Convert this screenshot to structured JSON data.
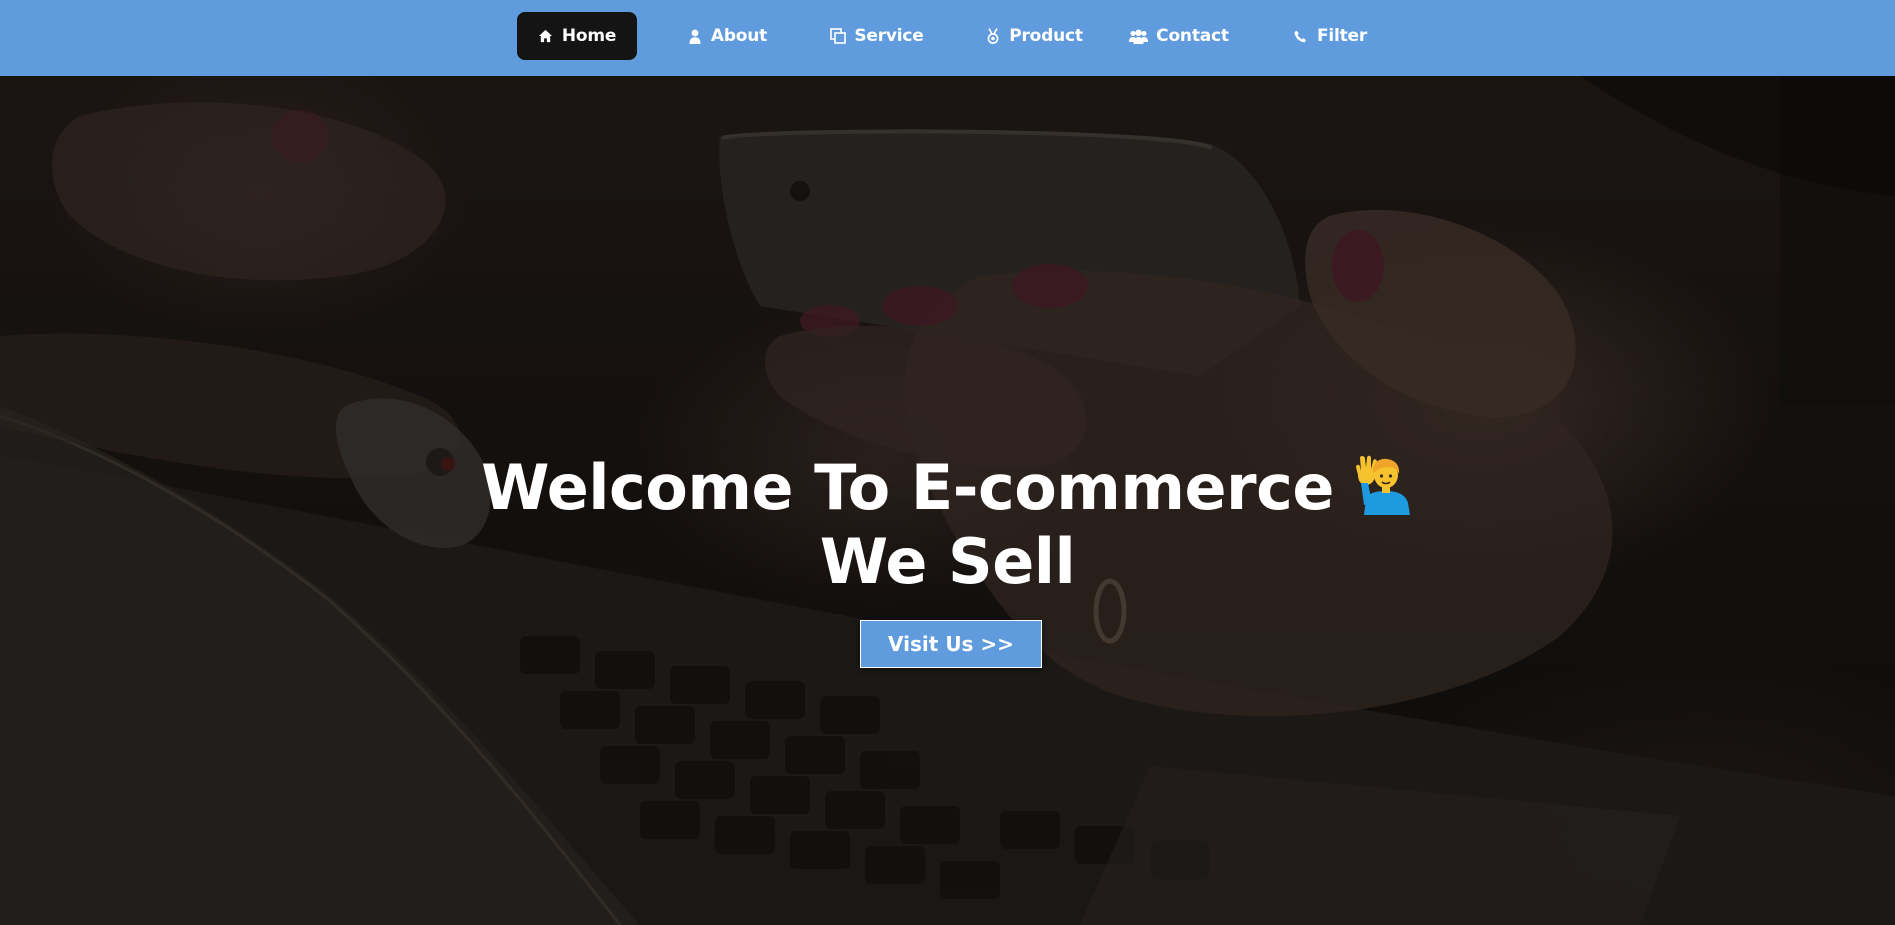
{
  "nav": {
    "items": [
      {
        "label": "Home",
        "icon": "home-icon",
        "active": true
      },
      {
        "label": "About",
        "icon": "user-icon",
        "active": false
      },
      {
        "label": "Service",
        "icon": "copy-icon",
        "active": false
      },
      {
        "label": "Product",
        "icon": "medal-icon",
        "active": false
      },
      {
        "label": "Contact",
        "icon": "users-icon",
        "active": false
      },
      {
        "label": "Filter",
        "icon": "phone-icon",
        "active": false
      }
    ]
  },
  "hero": {
    "title_line1": "Welcome To E-commerce",
    "title_line2": "We Sell",
    "emoji": "person-raising-hand-emoji",
    "button_label": "Visit Us >>"
  },
  "colors": {
    "nav_background": "#5f9bdd",
    "nav_active": "#141414",
    "button_background": "#5f9bdd",
    "text": "#ffffff"
  }
}
